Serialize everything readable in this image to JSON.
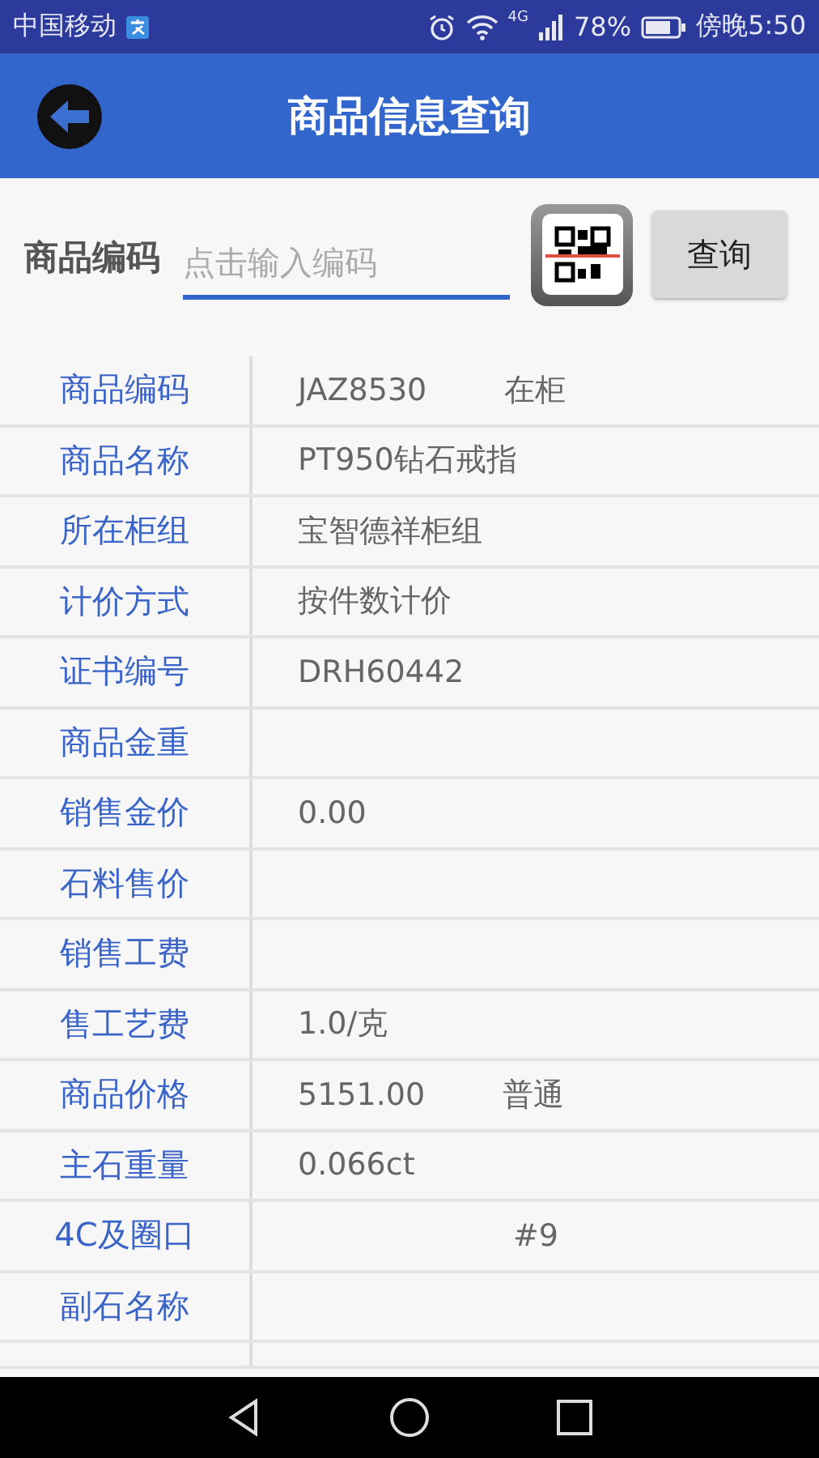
{
  "status_bar": {
    "carrier": "中国移动",
    "network": "4G",
    "battery": "78%",
    "time": "傍晚5:50"
  },
  "app_bar": {
    "title": "商品信息查询"
  },
  "search": {
    "label": "商品编码",
    "placeholder": "点击输入编码",
    "button": "查询"
  },
  "rows": [
    {
      "kind": "plain",
      "label": "商品编码",
      "value": "JAZ8530",
      "tag": "在柜"
    },
    {
      "kind": "plain",
      "label": "商品名称",
      "value": "PT950钻石戒指"
    },
    {
      "kind": "plain",
      "label": "所在柜组",
      "value": "宝智德祥柜组"
    },
    {
      "kind": "plain",
      "label": "计价方式",
      "value": "按件数计价"
    },
    {
      "kind": "plain",
      "label": "证书编号",
      "value": "DRH60442"
    },
    {
      "kind": "plain",
      "label": "商品金重"
    },
    {
      "kind": "plain",
      "label": "销售金价",
      "value": "0.00"
    },
    {
      "kind": "plain",
      "label": "石料售价"
    },
    {
      "kind": "plain",
      "label": "销售工费"
    },
    {
      "kind": "plain",
      "label": "售工艺费",
      "value": "1.0/克"
    },
    {
      "kind": "plain",
      "label": "商品价格",
      "value": "5151.00",
      "tag": "普通"
    },
    {
      "kind": "plain",
      "label": "主石重量",
      "value": "0.066ct"
    },
    {
      "kind": "centered",
      "label": "4C及圈口",
      "value": "#9"
    },
    {
      "kind": "plain",
      "label": "副石名称"
    },
    {
      "kind": "partial"
    }
  ]
}
